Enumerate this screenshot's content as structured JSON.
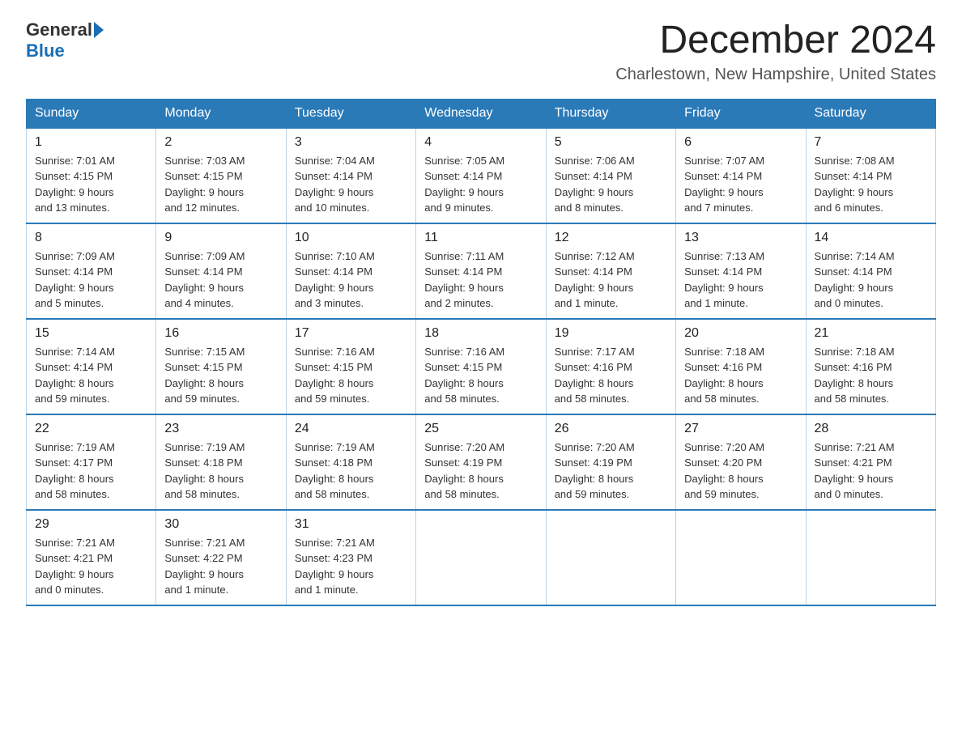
{
  "logo": {
    "general": "General",
    "blue": "Blue"
  },
  "title": "December 2024",
  "subtitle": "Charlestown, New Hampshire, United States",
  "days_of_week": [
    "Sunday",
    "Monday",
    "Tuesday",
    "Wednesday",
    "Thursday",
    "Friday",
    "Saturday"
  ],
  "weeks": [
    [
      {
        "day": "1",
        "sunrise": "7:01 AM",
        "sunset": "4:15 PM",
        "daylight": "9 hours and 13 minutes."
      },
      {
        "day": "2",
        "sunrise": "7:03 AM",
        "sunset": "4:15 PM",
        "daylight": "9 hours and 12 minutes."
      },
      {
        "day": "3",
        "sunrise": "7:04 AM",
        "sunset": "4:14 PM",
        "daylight": "9 hours and 10 minutes."
      },
      {
        "day": "4",
        "sunrise": "7:05 AM",
        "sunset": "4:14 PM",
        "daylight": "9 hours and 9 minutes."
      },
      {
        "day": "5",
        "sunrise": "7:06 AM",
        "sunset": "4:14 PM",
        "daylight": "9 hours and 8 minutes."
      },
      {
        "day": "6",
        "sunrise": "7:07 AM",
        "sunset": "4:14 PM",
        "daylight": "9 hours and 7 minutes."
      },
      {
        "day": "7",
        "sunrise": "7:08 AM",
        "sunset": "4:14 PM",
        "daylight": "9 hours and 6 minutes."
      }
    ],
    [
      {
        "day": "8",
        "sunrise": "7:09 AM",
        "sunset": "4:14 PM",
        "daylight": "9 hours and 5 minutes."
      },
      {
        "day": "9",
        "sunrise": "7:09 AM",
        "sunset": "4:14 PM",
        "daylight": "9 hours and 4 minutes."
      },
      {
        "day": "10",
        "sunrise": "7:10 AM",
        "sunset": "4:14 PM",
        "daylight": "9 hours and 3 minutes."
      },
      {
        "day": "11",
        "sunrise": "7:11 AM",
        "sunset": "4:14 PM",
        "daylight": "9 hours and 2 minutes."
      },
      {
        "day": "12",
        "sunrise": "7:12 AM",
        "sunset": "4:14 PM",
        "daylight": "9 hours and 1 minute."
      },
      {
        "day": "13",
        "sunrise": "7:13 AM",
        "sunset": "4:14 PM",
        "daylight": "9 hours and 1 minute."
      },
      {
        "day": "14",
        "sunrise": "7:14 AM",
        "sunset": "4:14 PM",
        "daylight": "9 hours and 0 minutes."
      }
    ],
    [
      {
        "day": "15",
        "sunrise": "7:14 AM",
        "sunset": "4:14 PM",
        "daylight": "8 hours and 59 minutes."
      },
      {
        "day": "16",
        "sunrise": "7:15 AM",
        "sunset": "4:15 PM",
        "daylight": "8 hours and 59 minutes."
      },
      {
        "day": "17",
        "sunrise": "7:16 AM",
        "sunset": "4:15 PM",
        "daylight": "8 hours and 59 minutes."
      },
      {
        "day": "18",
        "sunrise": "7:16 AM",
        "sunset": "4:15 PM",
        "daylight": "8 hours and 58 minutes."
      },
      {
        "day": "19",
        "sunrise": "7:17 AM",
        "sunset": "4:16 PM",
        "daylight": "8 hours and 58 minutes."
      },
      {
        "day": "20",
        "sunrise": "7:18 AM",
        "sunset": "4:16 PM",
        "daylight": "8 hours and 58 minutes."
      },
      {
        "day": "21",
        "sunrise": "7:18 AM",
        "sunset": "4:16 PM",
        "daylight": "8 hours and 58 minutes."
      }
    ],
    [
      {
        "day": "22",
        "sunrise": "7:19 AM",
        "sunset": "4:17 PM",
        "daylight": "8 hours and 58 minutes."
      },
      {
        "day": "23",
        "sunrise": "7:19 AM",
        "sunset": "4:18 PM",
        "daylight": "8 hours and 58 minutes."
      },
      {
        "day": "24",
        "sunrise": "7:19 AM",
        "sunset": "4:18 PM",
        "daylight": "8 hours and 58 minutes."
      },
      {
        "day": "25",
        "sunrise": "7:20 AM",
        "sunset": "4:19 PM",
        "daylight": "8 hours and 58 minutes."
      },
      {
        "day": "26",
        "sunrise": "7:20 AM",
        "sunset": "4:19 PM",
        "daylight": "8 hours and 59 minutes."
      },
      {
        "day": "27",
        "sunrise": "7:20 AM",
        "sunset": "4:20 PM",
        "daylight": "8 hours and 59 minutes."
      },
      {
        "day": "28",
        "sunrise": "7:21 AM",
        "sunset": "4:21 PM",
        "daylight": "9 hours and 0 minutes."
      }
    ],
    [
      {
        "day": "29",
        "sunrise": "7:21 AM",
        "sunset": "4:21 PM",
        "daylight": "9 hours and 0 minutes."
      },
      {
        "day": "30",
        "sunrise": "7:21 AM",
        "sunset": "4:22 PM",
        "daylight": "9 hours and 1 minute."
      },
      {
        "day": "31",
        "sunrise": "7:21 AM",
        "sunset": "4:23 PM",
        "daylight": "9 hours and 1 minute."
      },
      null,
      null,
      null,
      null
    ]
  ]
}
